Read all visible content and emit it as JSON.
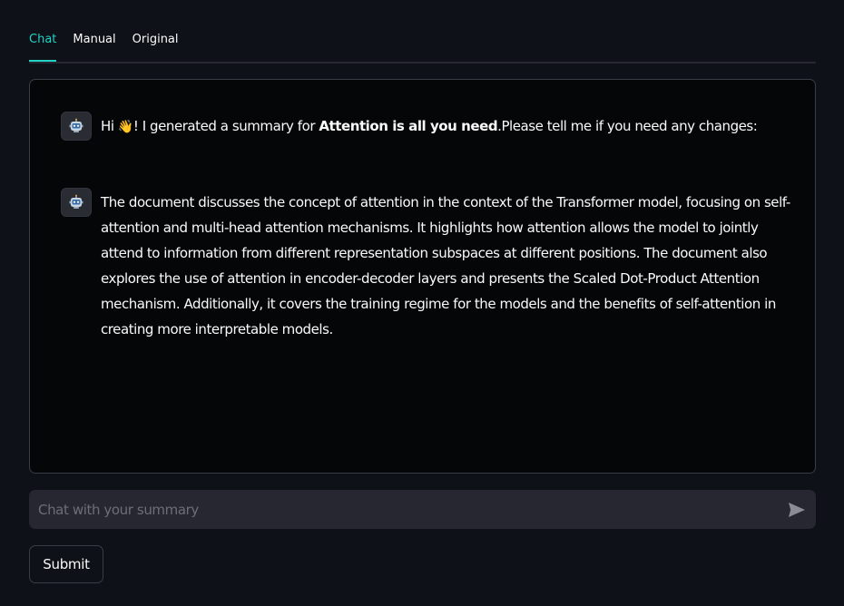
{
  "tabs": [
    {
      "label": "Chat",
      "active": true
    },
    {
      "label": "Manual",
      "active": false
    },
    {
      "label": "Original",
      "active": false
    }
  ],
  "messages": [
    {
      "avatar": "robot-icon",
      "prefix": "Hi ",
      "emoji": "👋",
      "middle": "! I generated a summary for ",
      "bold": "Attention is all you need",
      "suffix": ".Please tell me if you need any changes:"
    },
    {
      "avatar": "robot-icon",
      "text": "The document discusses the concept of attention in the context of the Transformer model, focusing on self-attention and multi-head attention mechanisms. It highlights how attention allows the model to jointly attend to information from different representation subspaces at different positions. The document also explores the use of attention in encoder-decoder layers and presents the Scaled Dot-Product Attention mechanism. Additionally, it covers the training regime for the models and the benefits of self-attention in creating more interpretable models."
    }
  ],
  "chat_input": {
    "placeholder": "Chat with your summary",
    "value": "",
    "send_icon": "send-icon"
  },
  "submit": {
    "label": "Submit"
  },
  "colors": {
    "accent": "#22d3c5",
    "background": "#0e1117",
    "input_bg": "#262730"
  }
}
